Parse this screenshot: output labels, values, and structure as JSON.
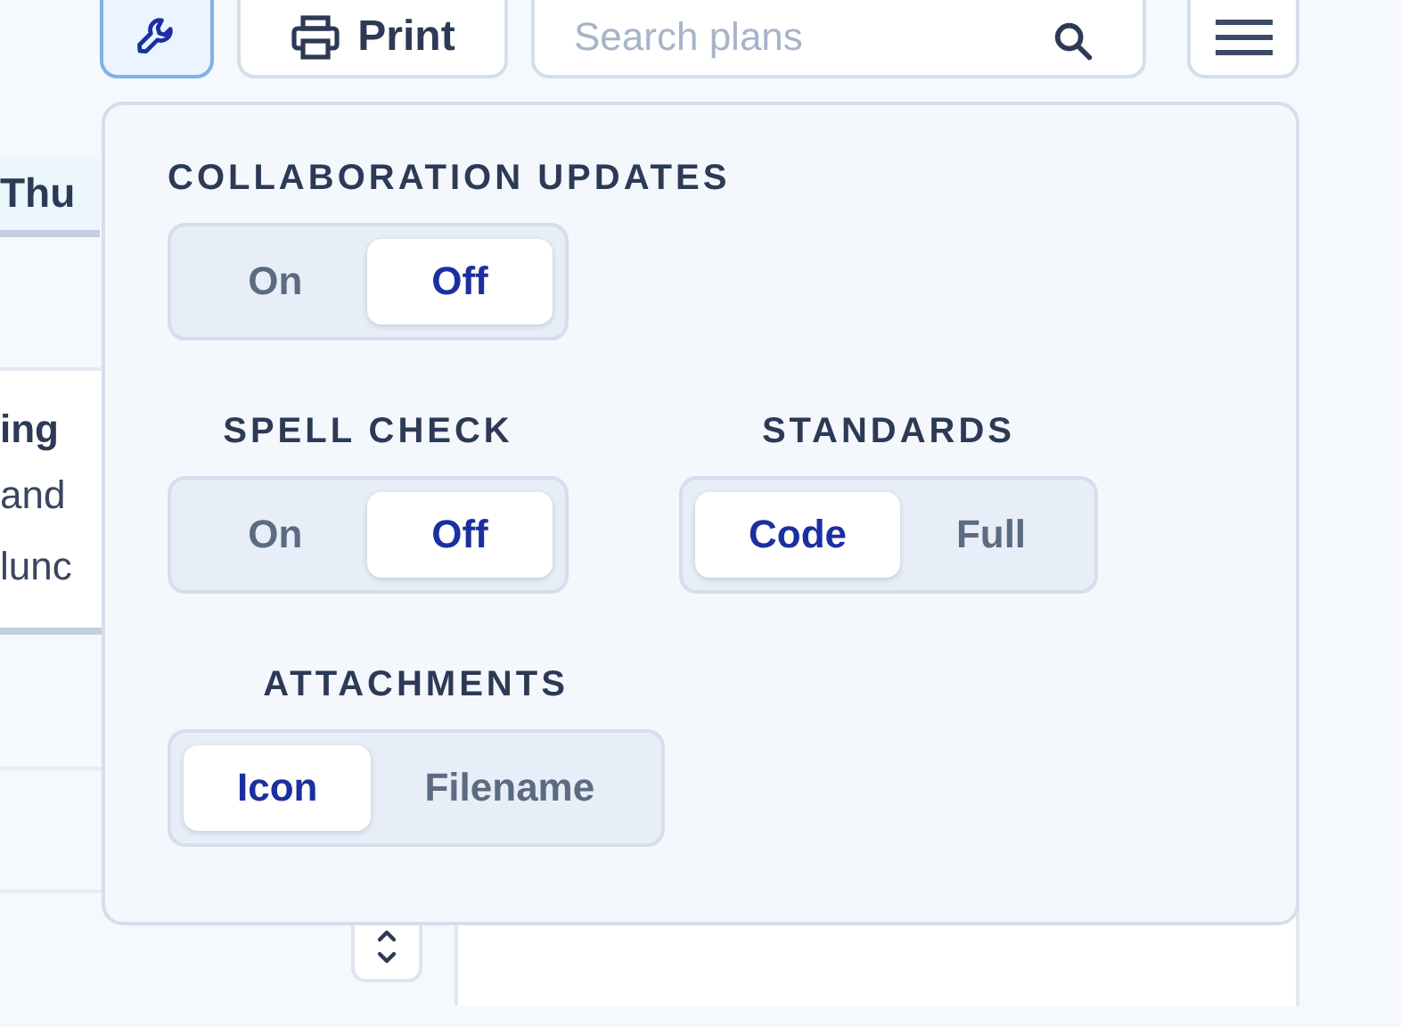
{
  "toolbar": {
    "items": [
      {
        "kind": "tools",
        "selected": true
      },
      {
        "kind": "print",
        "label": "Print",
        "selected": false
      },
      {
        "kind": "search",
        "placeholder": "Search plans"
      },
      {
        "kind": "menu",
        "selected": false
      }
    ]
  },
  "board": {
    "day_tab": {
      "label": "Thu"
    },
    "event_card": {
      "title": "ing",
      "lines": [
        "and",
        "lunc"
      ]
    }
  },
  "popover": {
    "rows": [
      [
        {
          "label": "COLLABORATION UPDATES",
          "options": [
            {
              "label": "On",
              "selected": false
            },
            {
              "label": "Off",
              "selected": true
            }
          ]
        }
      ],
      [
        {
          "label": "SPELL CHECK",
          "options": [
            {
              "label": "On",
              "selected": false
            },
            {
              "label": "Off",
              "selected": true
            }
          ]
        },
        {
          "label": "STANDARDS",
          "options": [
            {
              "label": "Code",
              "selected": true
            },
            {
              "label": "Full",
              "selected": false
            }
          ]
        }
      ],
      [
        {
          "label": "ATTACHMENTS",
          "options": [
            {
              "label": "Icon",
              "selected": true
            },
            {
              "label": "Filename",
              "selected": false
            }
          ]
        }
      ]
    ]
  }
}
